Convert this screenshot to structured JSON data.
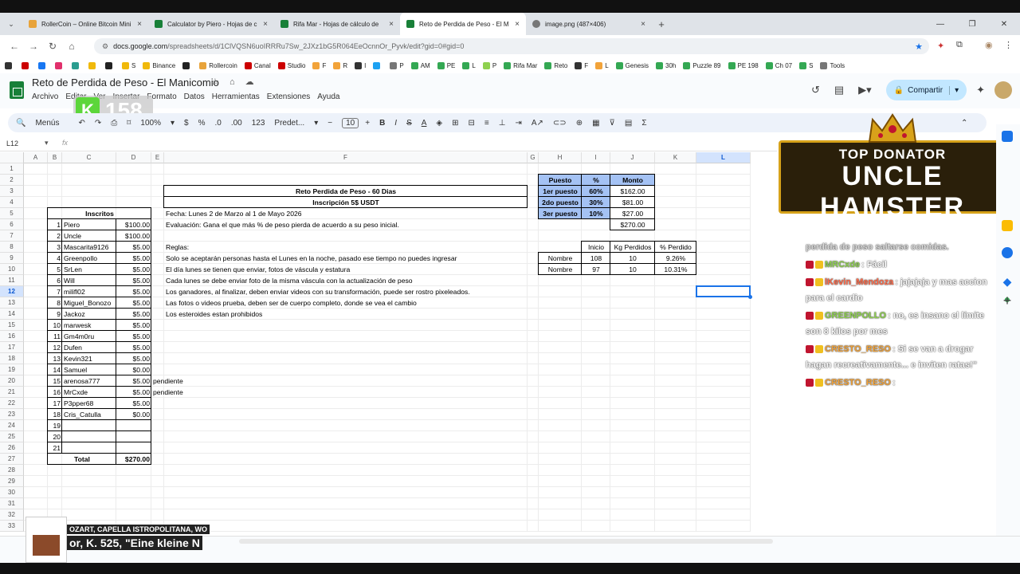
{
  "tabs": [
    {
      "title": "RollerCoin – Online Bitcoin Mini",
      "color": "#e8a33a"
    },
    {
      "title": "Calculator by Piero - Hojas de c",
      "color": "#188038"
    },
    {
      "title": "Rifa Mar - Hojas de cálculo de",
      "color": "#188038"
    },
    {
      "title": "Reto de Perdida de Peso - El M",
      "color": "#188038",
      "active": true
    },
    {
      "title": "image.png (487×406)",
      "color": "#777"
    }
  ],
  "url": {
    "domain": "docs.google.com",
    "path": "/spreadsheets/d/1ClVQSN6uoIRRRu7Sw_2JXz1bG5R064EeOcnnOr_Pyvk/edit?gid=0#gid=0"
  },
  "bookmarks": [
    "",
    "",
    "",
    "",
    "",
    "",
    "",
    "S",
    "Binance",
    "",
    "Rollercoin",
    "Canal",
    "Studio",
    "F",
    "R",
    "I",
    "",
    "P",
    "AM",
    "PE",
    "L",
    "P",
    "Rifa Mar",
    "Reto",
    "F",
    "L",
    "Genesis",
    "30h",
    "Puzzle 89",
    "PE 198",
    "Ch 07",
    "S",
    "Tools"
  ],
  "doc": {
    "title": "Reto de Perdida de Peso - El Manicomio",
    "menus": [
      "Archivo",
      "Editar",
      "Ver",
      "Insertar",
      "Formato",
      "Datos",
      "Herramientas",
      "Extensiones",
      "Ayuda"
    ],
    "share_label": "Compartir",
    "badge_letter": "K",
    "badge_number": "158"
  },
  "toolbar": {
    "search": "Menús",
    "zoom": "100%",
    "currency": "$",
    "percent": "%",
    "dec_less": ".0",
    "dec_more": ".00",
    "fmt": "123",
    "font": "Predet...",
    "font_size": "10"
  },
  "formula": {
    "namebox": "L12",
    "fx": "fx"
  },
  "columns": [
    "A",
    "B",
    "C",
    "D",
    "E",
    "F",
    "G",
    "H",
    "I",
    "J",
    "K",
    "L"
  ],
  "rows": [
    "1",
    "2",
    "3",
    "4",
    "5",
    "6",
    "7",
    "8",
    "9",
    "10",
    "11",
    "12",
    "13",
    "14",
    "15",
    "16",
    "17",
    "18",
    "19",
    "20",
    "21",
    "22",
    "23",
    "24",
    "25",
    "26",
    "27",
    "28",
    "29",
    "30",
    "31",
    "32",
    "33"
  ],
  "sheet": {
    "title1": "Reto Perdida de Peso - 60 Dias",
    "title2": "Inscripción 5$ USDT",
    "inscritos_header": "Inscritos",
    "inscritos": [
      {
        "n": "1",
        "name": "Piero",
        "amt": "$100.00",
        "note": ""
      },
      {
        "n": "2",
        "name": "Uncle",
        "amt": "$100.00",
        "note": ""
      },
      {
        "n": "3",
        "name": "Mascarita9126",
        "amt": "$5.00",
        "note": ""
      },
      {
        "n": "4",
        "name": "Greenpollo",
        "amt": "$5.00",
        "note": ""
      },
      {
        "n": "5",
        "name": "SrLen",
        "amt": "$5.00",
        "note": ""
      },
      {
        "n": "6",
        "name": "Will",
        "amt": "$5.00",
        "note": ""
      },
      {
        "n": "7",
        "name": "milifl02",
        "amt": "$5.00",
        "note": ""
      },
      {
        "n": "8",
        "name": "Miguel_Bonozo",
        "amt": "$5.00",
        "note": ""
      },
      {
        "n": "9",
        "name": "Jackoz",
        "amt": "$5.00",
        "note": ""
      },
      {
        "n": "10",
        "name": "marwesk",
        "amt": "$5.00",
        "note": ""
      },
      {
        "n": "11",
        "name": "Gm4m0ru",
        "amt": "$5.00",
        "note": ""
      },
      {
        "n": "12",
        "name": "Dufen",
        "amt": "$5.00",
        "note": ""
      },
      {
        "n": "13",
        "name": "Kevin321",
        "amt": "$5.00",
        "note": ""
      },
      {
        "n": "14",
        "name": "Samuel",
        "amt": "$0.00",
        "note": ""
      },
      {
        "n": "15",
        "name": "arenosa777",
        "amt": "$5.00",
        "note": "pendiente"
      },
      {
        "n": "16",
        "name": "MrCxde",
        "amt": "$5.00",
        "note": "pendiente"
      },
      {
        "n": "17",
        "name": "P3pper68",
        "amt": "$5.00",
        "note": ""
      },
      {
        "n": "18",
        "name": "Cris_Catulla",
        "amt": "$0.00",
        "note": ""
      },
      {
        "n": "19",
        "name": "",
        "amt": "",
        "note": ""
      },
      {
        "n": "20",
        "name": "",
        "amt": "",
        "note": ""
      },
      {
        "n": "21",
        "name": "",
        "amt": "",
        "note": ""
      }
    ],
    "total_label": "Total",
    "total_value": "$270.00",
    "info": [
      "Fecha: Lunes 2 de Marzo al 1 de Mayo 2026",
      "Evaluación: Gana el que más % de peso pierda de acuerdo a su peso inicial.",
      "",
      "Reglas:",
      "Solo se aceptarán personas hasta el Lunes en la noche, pasado ese tiempo no puedes ingresar",
      "El día lunes se tienen que enviar, fotos de váscula y estatura",
      "Cada lunes se debe enviar foto de la misma váscula con la actualización de peso",
      "Los ganadores, al finalizar, deben enviar videos con su transformación, puede ser rostro pixeleados.",
      "Las fotos o videos prueba, deben ser de cuerpo completo, donde se vea el cambio",
      "Los esteroides estan prohibidos"
    ],
    "prize_headers": [
      "Puesto",
      "%",
      "Monto"
    ],
    "prizes": [
      {
        "place": "1er puesto",
        "pct": "60%",
        "amount": "$162.00"
      },
      {
        "place": "2do puesto",
        "pct": "30%",
        "amount": "$81.00"
      },
      {
        "place": "3er puesto",
        "pct": "10%",
        "amount": "$27.00"
      }
    ],
    "prize_total": "$270.00",
    "progress_headers": [
      "Inicio",
      "Kg Perdidos",
      "% Perdido"
    ],
    "progress": [
      {
        "label": "Nombre",
        "start": "108",
        "lost": "10",
        "pct": "9.26%"
      },
      {
        "label": "Nombre",
        "start": "97",
        "lost": "10",
        "pct": "10.31%"
      }
    ]
  },
  "overlay": {
    "donator_title": "TOP DONATOR",
    "donator_name": "UNCLE HAMSTER",
    "chat": [
      {
        "name": "",
        "text": "perdida de peso saltarse comidas.",
        "color": "#ffffff"
      },
      {
        "name": "MRCxde",
        "text": ": Fácil",
        "color": "#8fd14f"
      },
      {
        "name": "lKevin_Mendoza",
        "text": ": jajajaja y mas accion para el cardio",
        "color": "#ff6b4a"
      },
      {
        "name": "GREENPOLLO",
        "text": ": no, es insano el límite son 8 kilos por mes",
        "color": "#8fd14f"
      },
      {
        "name": "CRESTO_RESO",
        "text": ": Si se van a drogar hagan recreativamente... e inviten ratas!\"",
        "color": "#f2a33a"
      },
      {
        "name": "CRESTO_RESO",
        "text": ":",
        "color": "#f2a33a"
      }
    ],
    "music_line1": "OZART, CAPELLA ISTROPOLITANA, WO",
    "music_line2": "or, K. 525, \"Eine kleine N"
  }
}
